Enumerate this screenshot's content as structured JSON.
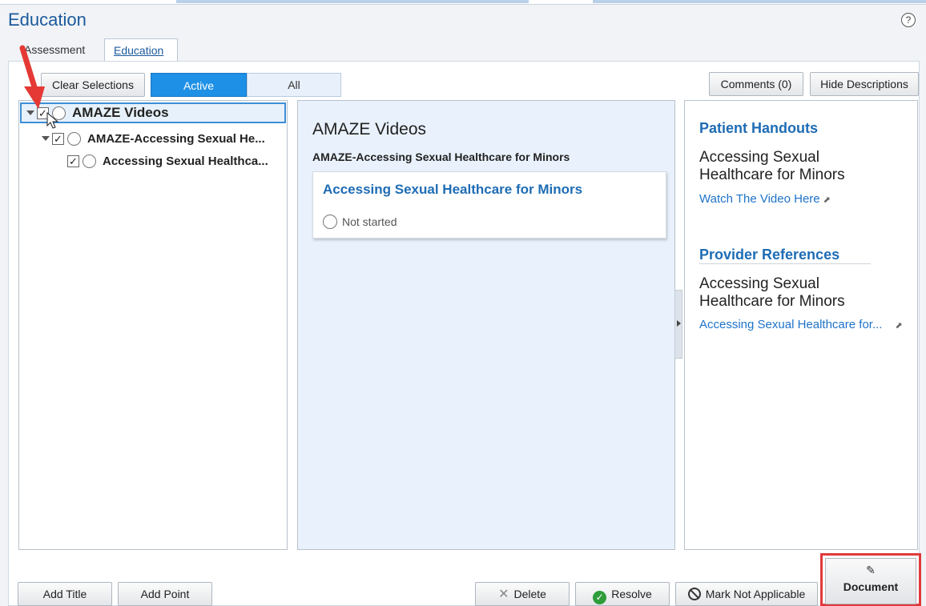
{
  "window": {
    "title": "Education",
    "help_icon": "?"
  },
  "tabs": [
    {
      "label": "Assessment",
      "active": false
    },
    {
      "label": "Education",
      "active": true
    }
  ],
  "toolbar": {
    "clear_selections": "Clear Selections",
    "filter_active": "Active",
    "filter_all": "All",
    "comments": "Comments (0)",
    "hide_descriptions": "Hide Descriptions"
  },
  "tree": {
    "items": [
      {
        "label": "AMAZE Videos",
        "checked": true,
        "level": 0,
        "selected": true
      },
      {
        "label": "AMAZE-Accessing Sexual He...",
        "checked": true,
        "level": 1
      },
      {
        "label": "Accessing Sexual Healthca...",
        "checked": true,
        "level": 2
      }
    ]
  },
  "detail": {
    "title": "AMAZE Videos",
    "subtitle": "AMAZE-Accessing Sexual Healthcare for Minors",
    "card_title": "Accessing Sexual Healthcare for Minors",
    "card_status": "Not started"
  },
  "resources": {
    "patient_handouts_heading": "Patient Handouts",
    "patient_item_title": "Accessing Sexual Healthcare for Minors",
    "patient_item_link": "Watch The Video Here",
    "provider_references_heading": "Provider References",
    "provider_item_title": "Accessing Sexual Healthcare for Minors",
    "provider_item_link": "Accessing Sexual Healthcare for..."
  },
  "footer": {
    "add_title": "Add Title",
    "add_point": "Add Point",
    "delete": "Delete",
    "resolve": "Resolve",
    "mark_not_applicable": "Mark Not Applicable",
    "document": "Document"
  },
  "colors": {
    "brand_blue": "#1c5a9c",
    "active_filter": "#1e90e6",
    "link": "#1e73c8",
    "highlight_red": "#e03a3a",
    "resolve_green": "#2e9d3a"
  },
  "icons": [
    "help-icon",
    "expand-caret-icon",
    "checkbox-icon",
    "radio-icon",
    "external-link-icon",
    "close-x-icon",
    "check-circle-icon",
    "no-entry-icon",
    "pencil-icon",
    "mouse-cursor-icon",
    "annotation-arrow"
  ]
}
